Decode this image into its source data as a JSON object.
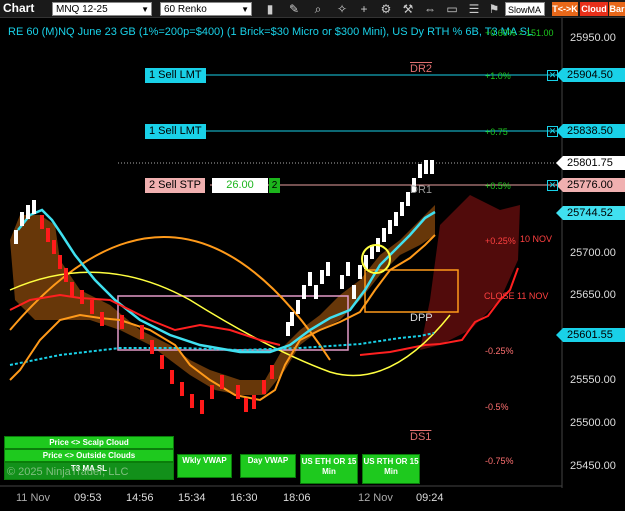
{
  "toolbar": {
    "title": "Chart",
    "instrument": "MNQ 12-25",
    "interval": "60 Renko",
    "indicator_select": "SlowMA",
    "btn_tick": "T<->K",
    "btn_cloud": "Cloud",
    "btn_bar": "Bar"
  },
  "header": "RE 60 (M)NQ June 23 GB (1%=200p=$400) (1 Brick=$30 Micro or $300 Mini), US Dy RTH % 6B, T3 MA SL",
  "price_axis": [
    "25950.00",
    "25700.00",
    "25650.00",
    "25550.00",
    "25500.00",
    "25450.00"
  ],
  "price_labels": {
    "p1": "25904.50",
    "p2": "25838.50",
    "p3": "25801.75",
    "p4": "25776.00",
    "p5": "25744.52",
    "p6": "25601.55"
  },
  "orders": {
    "sell_lmt_1": "1 Sell LMT",
    "sell_lmt_2": "1 Sell LMT",
    "sell_stp": "2 Sell STP",
    "stp_price": "26.00",
    "stp_qty": "2"
  },
  "levels": {
    "dr2": "DR2",
    "dr1": "DR1",
    "dpp": "DPP",
    "ds1": "DS1",
    "nov10": "10 NOV",
    "close_nov11": "CLOSE 11 NOV"
  },
  "percents": {
    "top": "+0.60% = 151.00",
    "p1": "+1.0%",
    "p075": "+0.75",
    "p05": "+0.5%",
    "p025": "+0.25%",
    "n025": "-0.25%",
    "n05": "-0.5%",
    "n075": "-0.75%"
  },
  "time_axis": [
    "11 Nov",
    "09:53",
    "14:56",
    "15:34",
    "16:30",
    "18:06",
    "12 Nov",
    "09:24"
  ],
  "buttons": {
    "scalp_cloud": "Price <> Scalp Cloud",
    "outside_clouds": "Price <> Outside Clouds",
    "t3_ma": "T3 MA SL",
    "wkly_vwap": "Wkly VWAP",
    "day_vwap": "Day VWAP",
    "eth_or": "US ETH OR 15 Min",
    "rth_or": "US RTH OR 15 Min"
  },
  "copyright": "© 2025 NinjaTrader, LLC",
  "colors": {
    "cyan": "#19d1e8",
    "up": "#ffffff",
    "down": "#ff1a1a",
    "orange": "#ff9a1a",
    "yellow": "#ffff40",
    "green": "#1ec91e"
  }
}
